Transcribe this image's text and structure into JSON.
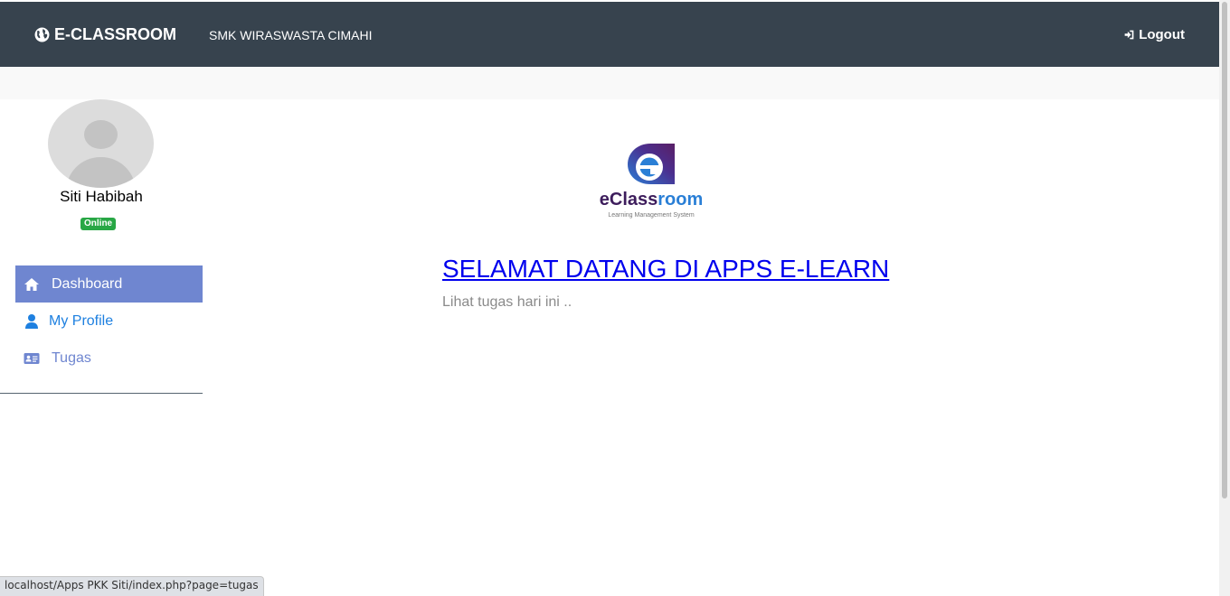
{
  "header": {
    "brand": "E-CLASSROOM",
    "brand_icon": "globe-icon",
    "school": "SMK WIRASWASTA CIMAHI",
    "logout_label": "Logout",
    "logout_icon": "sign-in-icon",
    "background_color": "#37434e"
  },
  "user": {
    "name": "Siti Habibah",
    "status": "Online",
    "status_color": "#28a745"
  },
  "sidebar": {
    "items": [
      {
        "label": "Dashboard",
        "icon": "home-icon",
        "active": true
      },
      {
        "label": "My Profile",
        "icon": "user-icon",
        "active": false
      },
      {
        "label": "Tugas",
        "icon": "id-card-icon",
        "active": false
      }
    ],
    "active_color": "#6f86d0"
  },
  "main": {
    "logo_text_1": "eClass",
    "logo_text_2": "room",
    "logo_subtitle": "Learning Management System",
    "welcome": "SELAMAT DATANG DI APPS E-LEARN",
    "subtext": "Lihat tugas hari ini .."
  },
  "browser": {
    "status_url": "localhost/Apps PKK Siti/index.php?page=tugas"
  }
}
